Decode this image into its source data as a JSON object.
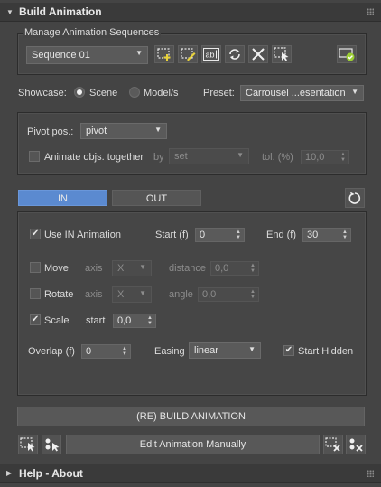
{
  "rollout_build": {
    "title": "Build Animation"
  },
  "sequences": {
    "group_label": "Manage Animation Sequences",
    "selected": "Sequence 01",
    "icons": [
      "add-sequence-icon",
      "edit-sequence-icon",
      "rename-sequence-icon",
      "refresh-icon",
      "delete-icon",
      "select-sequence-icon",
      "confirm-sequence-icon"
    ]
  },
  "showcase": {
    "label": "Showcase:",
    "option_scene": "Scene",
    "option_models": "Model/s",
    "selected": "Scene",
    "preset_label": "Preset:",
    "preset_value": "Carrousel ...esentation"
  },
  "pivot": {
    "label": "Pivot pos.:",
    "value": "pivot",
    "animate_together_label": "Animate objs. together",
    "by_label": "by",
    "by_value": "set",
    "tol_label": "tol. (%)",
    "tol_value": "10,0"
  },
  "tabs": {
    "in": "IN",
    "out": "OUT",
    "active": "IN"
  },
  "anim": {
    "use_in_label": "Use IN Animation",
    "use_in_checked": true,
    "start_label": "Start (f)",
    "start_value": "0",
    "end_label": "End (f)",
    "end_value": "30",
    "move_label": "Move",
    "move_checked": false,
    "move_axis_label": "axis",
    "move_axis_value": "X",
    "distance_label": "distance",
    "distance_value": "0,0",
    "rotate_label": "Rotate",
    "rotate_checked": false,
    "rotate_axis_label": "axis",
    "rotate_axis_value": "X",
    "angle_label": "angle",
    "angle_value": "0,0",
    "scale_label": "Scale",
    "scale_checked": true,
    "scale_start_label": "start",
    "scale_start_value": "0,0",
    "overlap_label": "Overlap (f)",
    "overlap_value": "0",
    "easing_label": "Easing",
    "easing_value": "linear",
    "start_hidden_label": "Start Hidden",
    "start_hidden_checked": true
  },
  "actions": {
    "build_label": "(RE) BUILD ANIMATION",
    "edit_label": "Edit Animation Manually"
  },
  "rollout_help": {
    "title": "Help - About"
  }
}
